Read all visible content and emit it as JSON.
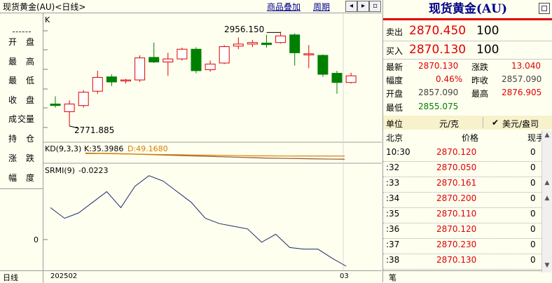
{
  "header": {
    "title": "现货黄金(AU)<日线>",
    "overlay_link": "商品叠加",
    "period_link": "周期"
  },
  "left_panel": {
    "items": [
      {
        "label": "开",
        "value": "盘"
      },
      {
        "label": "最",
        "value": "高"
      },
      {
        "label": "最",
        "value": "低"
      },
      {
        "label": "收",
        "value": "盘"
      },
      {
        "label": "成",
        "value": "交量"
      },
      {
        "label": "持",
        "value": "仓"
      },
      {
        "label": "涨",
        "value": "跌"
      },
      {
        "label": "幅",
        "value": "度"
      }
    ]
  },
  "chart": {
    "k_label": "K",
    "high_label": "2956.150",
    "low_label": "2771.885",
    "kd_label": "KD(9,3,3)",
    "kd_k": "K:35.3986",
    "kd_d": "D:49.1680",
    "srmi_label": "SRMI(9)",
    "srmi_value": "-0.0223",
    "zero_label": "0",
    "x_start": "202502",
    "x_end": "03",
    "period_tab": "日线",
    "candles": [
      {
        "o": 2815,
        "h": 2830,
        "l": 2808,
        "c": 2812
      },
      {
        "o": 2800,
        "h": 2822,
        "l": 2772,
        "c": 2815
      },
      {
        "o": 2812,
        "h": 2842,
        "l": 2808,
        "c": 2838
      },
      {
        "o": 2840,
        "h": 2880,
        "l": 2835,
        "c": 2867
      },
      {
        "o": 2868,
        "h": 2873,
        "l": 2850,
        "c": 2858
      },
      {
        "o": 2860,
        "h": 2864,
        "l": 2855,
        "c": 2862
      },
      {
        "o": 2862,
        "h": 2910,
        "l": 2858,
        "c": 2905
      },
      {
        "o": 2906,
        "h": 2935,
        "l": 2895,
        "c": 2897
      },
      {
        "o": 2897,
        "h": 2915,
        "l": 2870,
        "c": 2903
      },
      {
        "o": 2903,
        "h": 2925,
        "l": 2900,
        "c": 2922
      },
      {
        "o": 2922,
        "h": 2926,
        "l": 2875,
        "c": 2880
      },
      {
        "o": 2882,
        "h": 2900,
        "l": 2878,
        "c": 2893
      },
      {
        "o": 2895,
        "h": 2930,
        "l": 2893,
        "c": 2927
      },
      {
        "o": 2928,
        "h": 2945,
        "l": 2922,
        "c": 2932
      },
      {
        "o": 2932,
        "h": 2940,
        "l": 2926,
        "c": 2935
      },
      {
        "o": 2934,
        "h": 2950,
        "l": 2925,
        "c": 2931
      },
      {
        "o": 2935,
        "h": 2956,
        "l": 2933,
        "c": 2948
      },
      {
        "o": 2950,
        "h": 2953,
        "l": 2890,
        "c": 2915
      },
      {
        "o": 2912,
        "h": 2930,
        "l": 2885,
        "c": 2913
      },
      {
        "o": 2910,
        "h": 2912,
        "l": 2868,
        "c": 2873
      },
      {
        "o": 2875,
        "h": 2880,
        "l": 2835,
        "c": 2857
      },
      {
        "o": 2857,
        "h": 2876,
        "l": 2855,
        "c": 2870
      }
    ],
    "kd_k_series": [
      62,
      61,
      60,
      58,
      56,
      54,
      52,
      50,
      48,
      46,
      44,
      42,
      40,
      39,
      38,
      37,
      36,
      35.4
    ],
    "kd_d_series": [
      60,
      60,
      59,
      58,
      57,
      56,
      55,
      54,
      53,
      52,
      51,
      50,
      50,
      49.5,
      49.3,
      49.2,
      49.2,
      49.17
    ],
    "srmi_series": [
      0.06,
      0.04,
      0.05,
      0.07,
      0.09,
      0.06,
      0.1,
      0.12,
      0.11,
      0.09,
      0.07,
      0.04,
      0.03,
      0.025,
      0.02,
      -0.005,
      0.01,
      -0.015,
      -0.018,
      -0.018,
      -0.035,
      -0.05
    ]
  },
  "right_panel": {
    "title": "现货黄金(AU)",
    "sell_label": "卖出",
    "sell_price": "2870.450",
    "sell_qty": "100",
    "buy_label": "买入",
    "buy_price": "2870.130",
    "buy_qty": "100",
    "stats": [
      {
        "label": "最新",
        "value": "2870.130",
        "label2": "涨跌",
        "value2": "13.040"
      },
      {
        "label": "幅度",
        "value": "0.46%",
        "label2": "昨收",
        "value2": "2857.090"
      },
      {
        "label": "开盘",
        "value": "2857.090",
        "label2": "最高",
        "value2": "2876.905"
      },
      {
        "label": "最低",
        "value": "2855.075",
        "label2": "",
        "value2": ""
      }
    ],
    "unit_label": "单位",
    "unit_value": "元/克",
    "currency_option": "美元/盎司",
    "ticks_header": {
      "col1": "北京",
      "col2": "价格",
      "col3": "现手"
    },
    "ticks": [
      {
        "time": "10:30",
        "price": "2870.120",
        "qty": "0"
      },
      {
        "time": ":32",
        "price": "2870.050",
        "qty": "0"
      },
      {
        "time": ":33",
        "price": "2870.161",
        "qty": "0"
      },
      {
        "time": ":34",
        "price": "2870.200",
        "qty": "0"
      },
      {
        "time": ":35",
        "price": "2870.110",
        "qty": "0"
      },
      {
        "time": ":36",
        "price": "2870.120",
        "qty": "0"
      },
      {
        "time": ":37",
        "price": "2870.230",
        "qty": "0"
      },
      {
        "time": ":38",
        "price": "2870.130",
        "qty": "0"
      }
    ],
    "bottom_tab": "笔"
  }
}
